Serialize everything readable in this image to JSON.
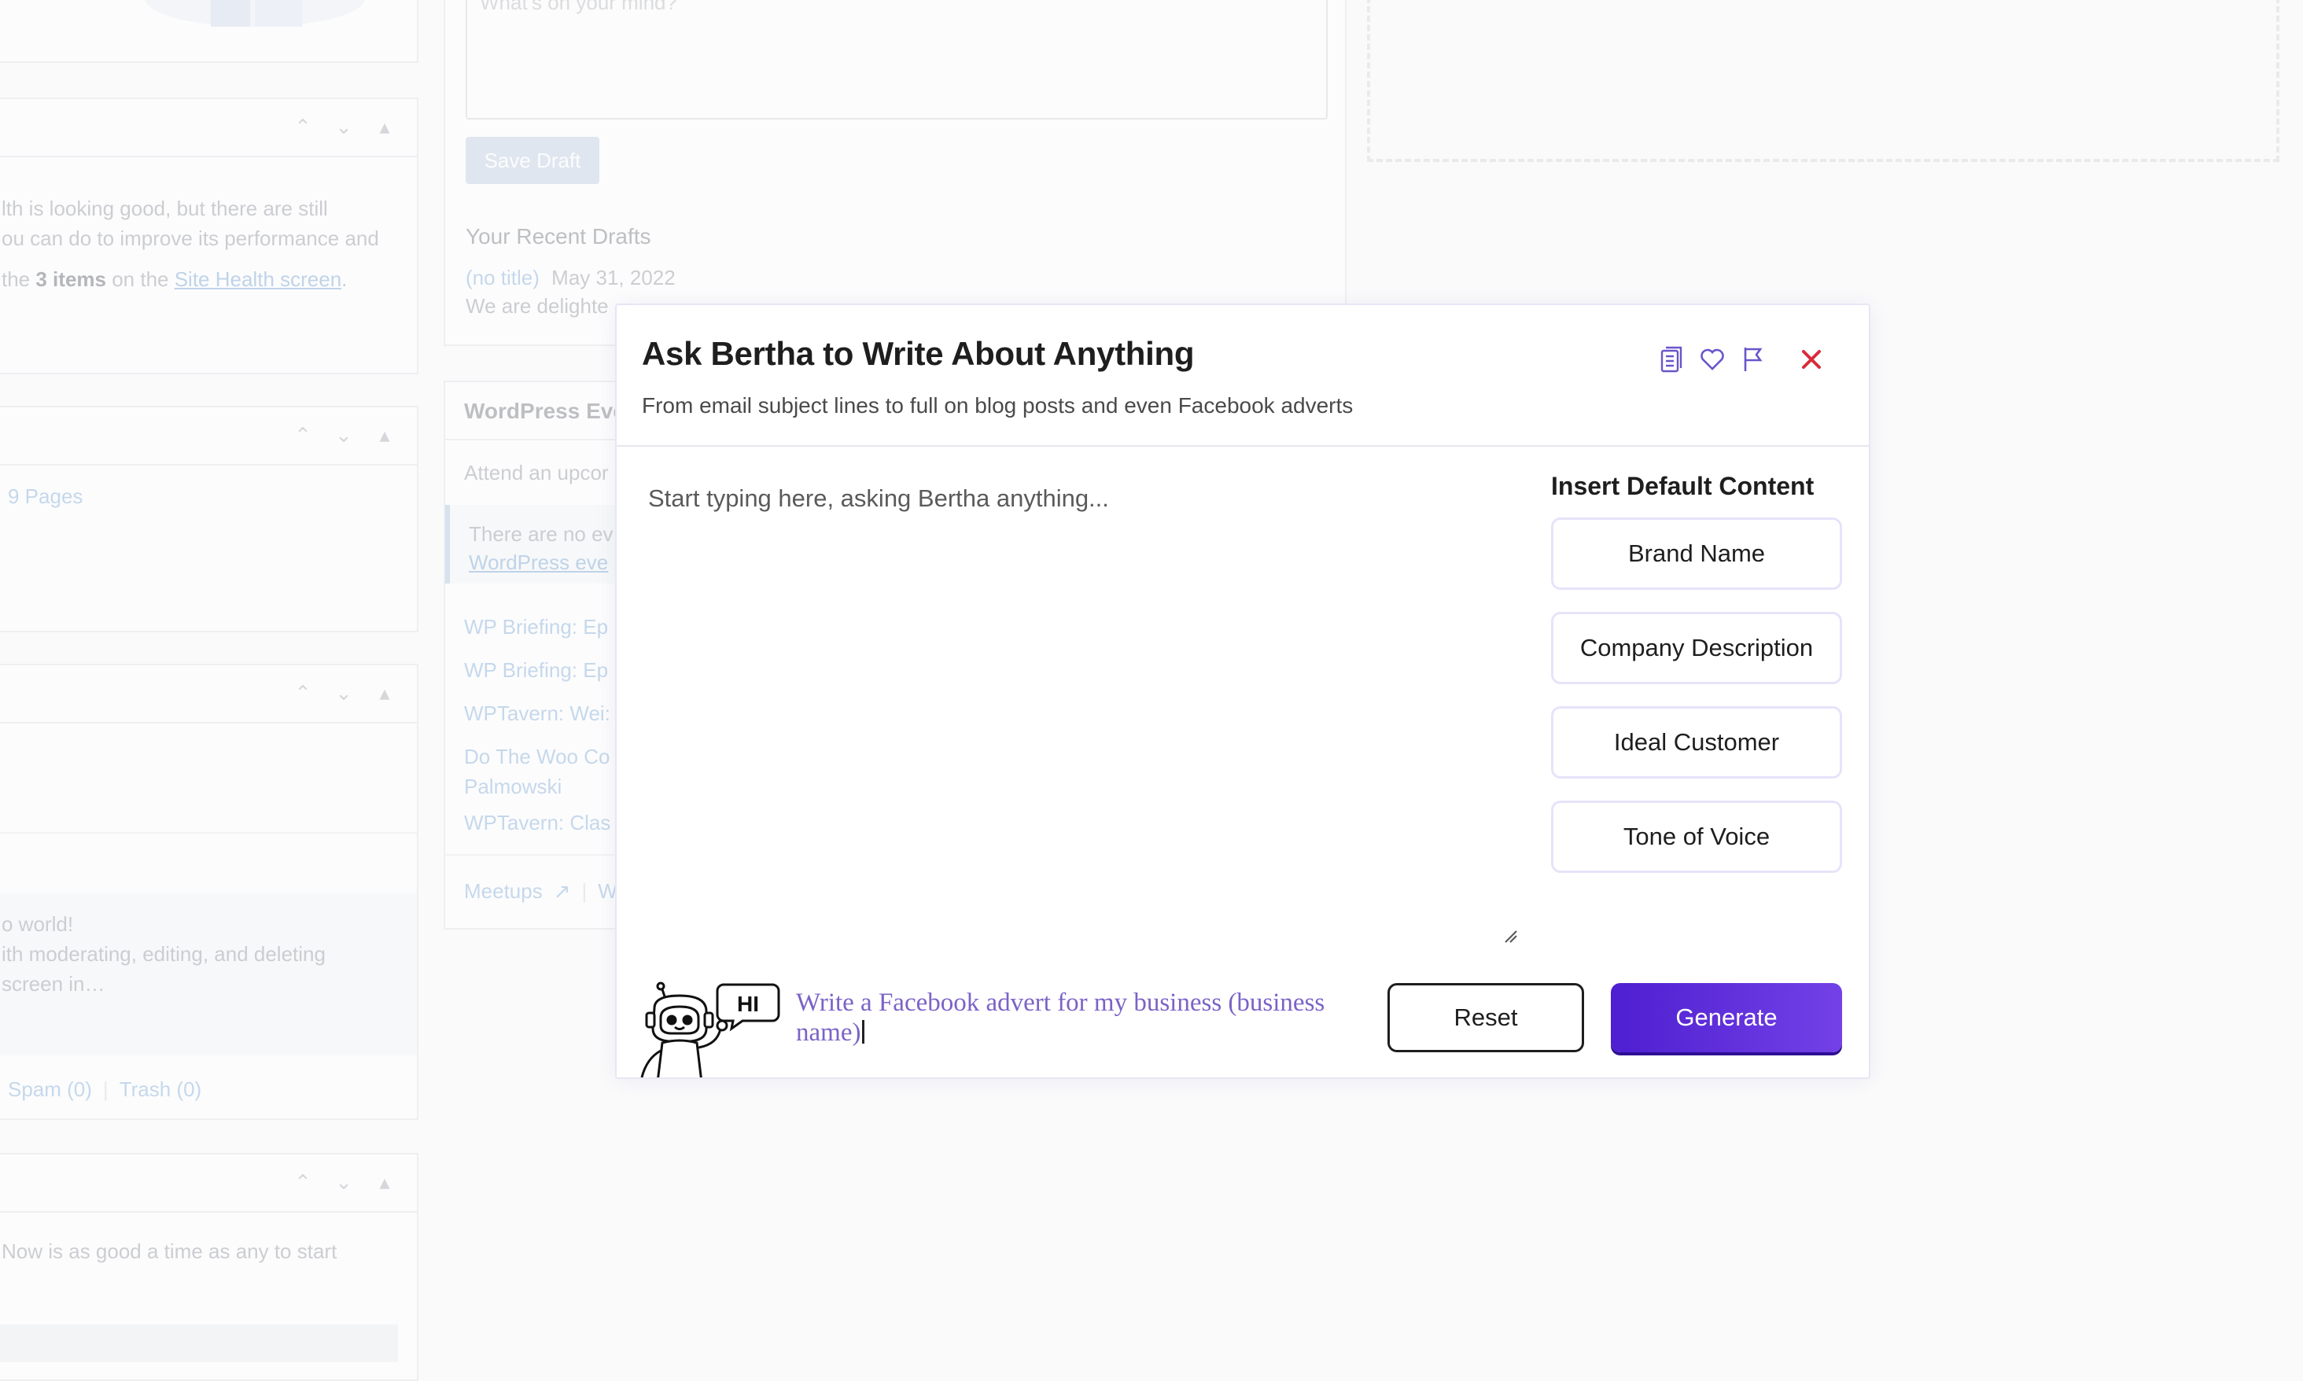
{
  "background": {
    "whats_on_mind_placeholder": "What’s on your mind?",
    "save_draft_label": "Save Draft",
    "recent_drafts_heading": "Your Recent Drafts",
    "draft_title": "(no title)",
    "draft_date": "May 31, 2022",
    "draft_excerpt": "We are delighte",
    "site_health_line1": "lth is looking good, but there are still",
    "site_health_line2": "ou can do to improve its performance and",
    "site_health_line3_pre": "the ",
    "site_health_items": "3 items",
    "site_health_line3_mid": " on the ",
    "site_health_link": "Site Health screen",
    "site_health_line3_end": ".",
    "pages_count": "9 Pages",
    "comment_line1": "o world!",
    "comment_line2": "ith moderating, editing, and deleting",
    "comment_line3": "screen in…",
    "spam_label": "Spam (0)",
    "trash_label": "Trash (0)",
    "start_text": "Now is as good a time as any to start",
    "events_title": "WordPress Eve",
    "attend_text": "Attend an upcor",
    "no_events_line1": "There are no ev",
    "no_events_link": "WordPress eve",
    "news_items": [
      "WP Briefing: Ep",
      "WP Briefing: Ep",
      "WPTavern: Wei:",
      "Do The Woo Co",
      "Palmowski",
      "WPTavern: Clas"
    ],
    "meetups_label": "Meetups",
    "w_label": "W"
  },
  "modal": {
    "title": "Ask Bertha to Write About Anything",
    "subtitle": "From email subject lines to full on blog posts and even Facebook adverts",
    "prompt_placeholder": "Start typing here, asking Bertha anything...",
    "insert_default_title": "Insert Default Content",
    "default_buttons": [
      "Brand Name",
      "Company Description",
      "Ideal Customer",
      "Tone of Voice"
    ],
    "robot_greeting": "HI",
    "hint_text": "Write a Facebook advert for my business (business name)",
    "reset_label": "Reset",
    "generate_label": "Generate",
    "icons": [
      "document-icon",
      "heart-icon",
      "flag-icon",
      "close-icon"
    ],
    "colors": {
      "accent": "#6a55c9",
      "close": "#d92b3a",
      "generate_start": "#4e1fd1",
      "generate_end": "#7341e6",
      "hint": "#7b63c6"
    }
  }
}
